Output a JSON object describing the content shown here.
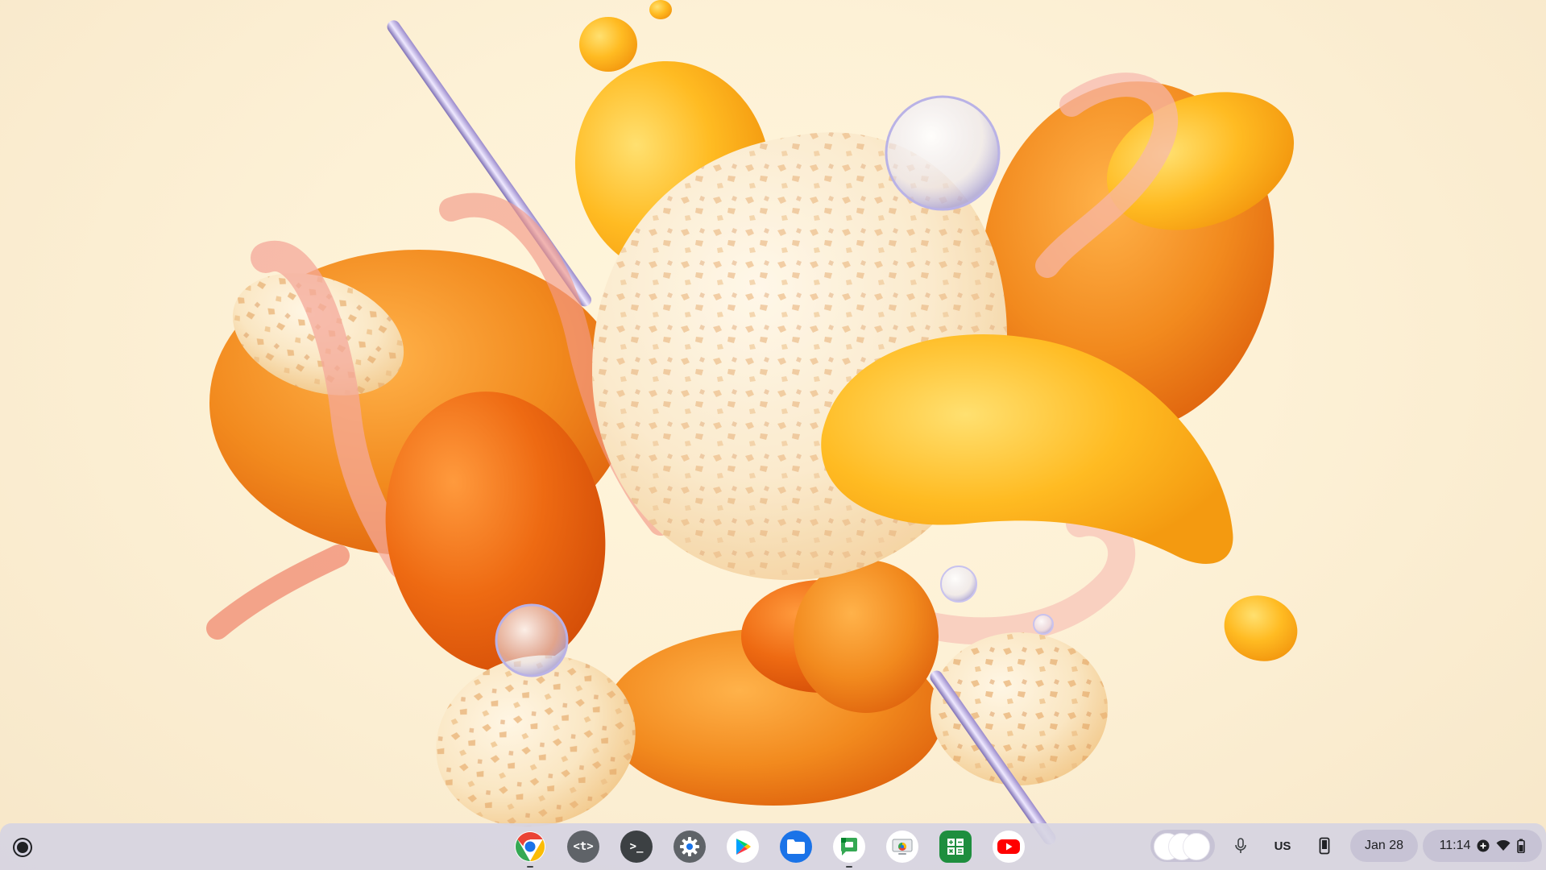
{
  "wallpaper": {
    "style": "orange and yellow glossy abstract 3D shapes",
    "colors": {
      "background": "#fdf1d6",
      "orange": "#f28a1e",
      "deep_orange": "#ee6a12",
      "yellow": "#ffbb22",
      "pink_ribbon": "#f4a89a",
      "cream": "#fae6c2",
      "chrome_rod": "#c6b6e6"
    }
  },
  "shelf": {
    "launcher": {
      "icon": "launcher-icon"
    },
    "pinned_apps": [
      {
        "name": "Google Chrome",
        "icon": "chrome-icon",
        "running": true
      },
      {
        "name": "Text",
        "icon": "caret-text-icon",
        "glyph": "<t>",
        "running": false
      },
      {
        "name": "Terminal",
        "icon": "terminal-icon",
        "glyph": ">_",
        "running": false
      },
      {
        "name": "Settings",
        "icon": "gear-icon",
        "running": false
      },
      {
        "name": "Play Store",
        "icon": "play-store-icon",
        "running": false
      },
      {
        "name": "Files",
        "icon": "files-folder-icon",
        "running": false
      },
      {
        "name": "Google Chat",
        "icon": "chat-icon",
        "running": true
      },
      {
        "name": "Chrome Remote Desktop",
        "icon": "remote-desktop-icon",
        "running": false
      },
      {
        "name": "Calculator",
        "icon": "calculator-icon",
        "running": false
      },
      {
        "name": "YouTube",
        "icon": "youtube-icon",
        "running": false
      }
    ],
    "tray": {
      "holding_space_icon": "holding-space-icon",
      "mic_icon": "microphone-icon",
      "ime_label": "US",
      "phone_hub_icon": "phone-icon",
      "date": "Jan 28",
      "time": "11:14",
      "status_icons": [
        "add-circle-icon",
        "wifi-icon",
        "battery-icon"
      ]
    }
  },
  "colors": {
    "shelf_bg": "#d6d4e2",
    "tray_pill": "#c4c1d4",
    "text": "#202124"
  }
}
